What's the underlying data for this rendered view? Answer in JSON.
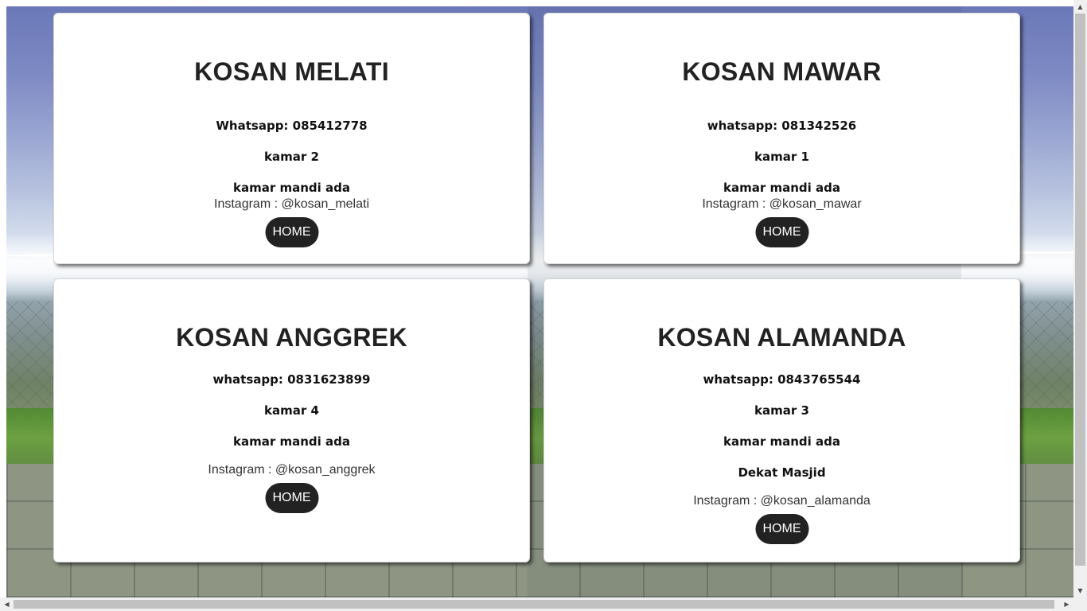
{
  "cards": [
    {
      "title": "KOSAN MELATI",
      "lines": [
        "Whatsapp: 085412778",
        "kamar 2",
        "kamar mandi ada"
      ],
      "instagram": "Instagram : @kosan_melati",
      "button": "HOME"
    },
    {
      "title": "KOSAN MAWAR",
      "lines": [
        "whatsapp: 081342526",
        "kamar 1",
        "kamar mandi ada"
      ],
      "instagram": "Instagram : @kosan_mawar",
      "button": "HOME"
    },
    {
      "title": "KOSAN ANGGREK",
      "lines": [
        "whatsapp: 0831623899",
        "kamar 4",
        "kamar mandi ada"
      ],
      "instagram": "Instagram : @kosan_anggrek",
      "button": "HOME"
    },
    {
      "title": "KOSAN ALAMANDA",
      "lines": [
        "whatsapp: 0843765544",
        "kamar 3",
        "kamar mandi ada",
        "Dekat Masjid"
      ],
      "instagram": "Instagram : @kosan_alamanda",
      "button": "HOME"
    }
  ],
  "scrollbars": {
    "up_icon": "triangle-up-icon",
    "down_icon": "triangle-down-icon",
    "left_icon": "triangle-left-icon",
    "right_icon": "triangle-right-icon",
    "up_glyph": "▲",
    "down_glyph": "▼",
    "left_glyph": "◀",
    "right_glyph": "▶"
  },
  "colors": {
    "button_bg": "#222222",
    "title": "#222222"
  }
}
